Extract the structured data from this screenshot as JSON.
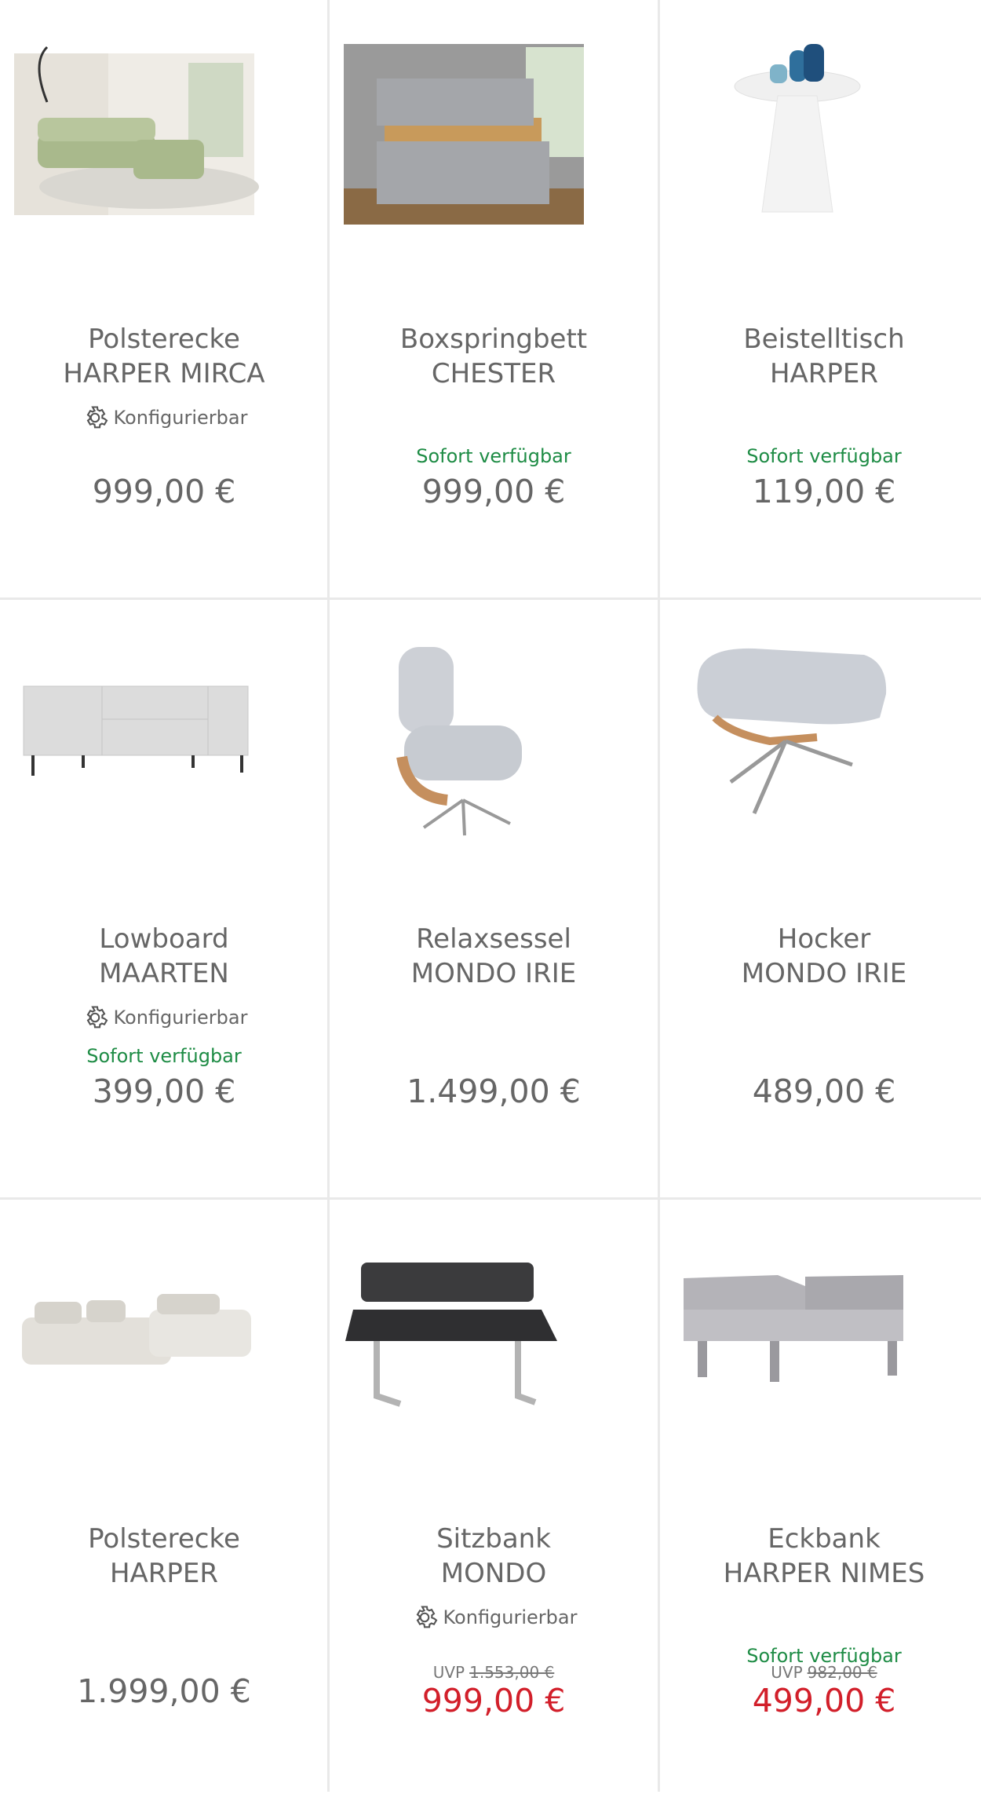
{
  "products": [
    {
      "line1": "Polsterecke",
      "line2": "HARPER MIRCA",
      "config": "Konfigurierbar",
      "avail": "",
      "uvp_label": "",
      "uvp_value": "",
      "price": "999,00 €",
      "sale": false,
      "image": "sofa-sage-corner"
    },
    {
      "line1": "Boxspringbett",
      "line2": "CHESTER",
      "config": "",
      "avail": "Sofort verfügbar",
      "uvp_label": "",
      "uvp_value": "",
      "price": "999,00 €",
      "sale": false,
      "image": "bed-grey-quilted"
    },
    {
      "line1": "Beistelltisch",
      "line2": "HARPER",
      "config": "",
      "avail": "Sofort verfügbar",
      "uvp_label": "",
      "uvp_value": "",
      "price": "119,00 €",
      "sale": false,
      "image": "side-table-white"
    },
    {
      "line1": "Lowboard",
      "line2": "MAARTEN",
      "config": "Konfigurierbar",
      "avail": "Sofort verfügbar",
      "uvp_label": "",
      "uvp_value": "",
      "price": "399,00 €",
      "sale": false,
      "image": "lowboard-grey"
    },
    {
      "line1": "Relaxsessel",
      "line2": "MONDO IRIE",
      "config": "",
      "avail": "",
      "uvp_label": "",
      "uvp_value": "",
      "price": "1.499,00 €",
      "sale": false,
      "image": "lounge-chair"
    },
    {
      "line1": "Hocker",
      "line2": "MONDO IRIE",
      "config": "",
      "avail": "",
      "uvp_label": "",
      "uvp_value": "",
      "price": "489,00 €",
      "sale": false,
      "image": "footstool"
    },
    {
      "line1": "Polsterecke",
      "line2": "HARPER",
      "config": "",
      "avail": "",
      "uvp_label": "",
      "uvp_value": "",
      "price": "1.999,00 €",
      "sale": false,
      "image": "sofa-beige-corner"
    },
    {
      "line1": "Sitzbank",
      "line2": "MONDO",
      "config": "Konfigurierbar",
      "avail": "",
      "uvp_label": "UVP",
      "uvp_value": "1.553,00 €",
      "price": "999,00 €",
      "sale": true,
      "image": "bench-dark"
    },
    {
      "line1": "Eckbank",
      "line2": "HARPER NIMES",
      "config": "",
      "avail": "Sofort verfügbar",
      "uvp_label": "UVP",
      "uvp_value": "982,00 €",
      "price": "499,00 €",
      "sale": true,
      "image": "corner-bench-grey"
    }
  ],
  "colors": {
    "text": "#666666",
    "available": "#1e8c45",
    "sale": "#d21f2a",
    "divider": "#e9e9e9"
  }
}
